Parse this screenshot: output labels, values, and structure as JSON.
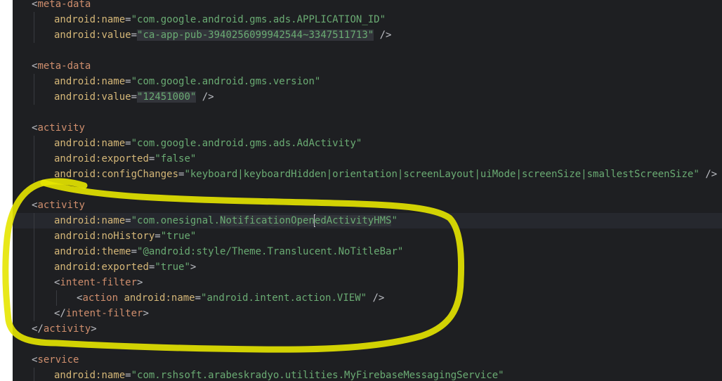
{
  "editor": {
    "lines": [
      {
        "id": "l1",
        "parts": [
          {
            "t": "<",
            "c": "p"
          },
          {
            "t": "meta-data",
            "c": "kw-tag"
          }
        ]
      },
      {
        "id": "l2",
        "parts": [
          {
            "t": "android:",
            "c": "kw-ns"
          },
          {
            "t": "name",
            "c": "kw-ns"
          },
          {
            "t": "=",
            "c": "p"
          },
          {
            "t": "\"com.google.android.gms.ads.APPLICATION_ID\"",
            "c": "val"
          }
        ]
      },
      {
        "id": "l3",
        "parts": [
          {
            "t": "android:",
            "c": "kw-ns"
          },
          {
            "t": "value",
            "c": "kw-ns"
          },
          {
            "t": "=",
            "c": "p"
          },
          {
            "t": "\"ca-app-pub-3940256099942544~3347511713\"",
            "c": "val hl"
          },
          {
            "t": " />",
            "c": "p"
          }
        ]
      },
      {
        "id": "l4",
        "parts": []
      },
      {
        "id": "l5",
        "parts": [
          {
            "t": "<",
            "c": "p"
          },
          {
            "t": "meta-data",
            "c": "kw-tag"
          }
        ]
      },
      {
        "id": "l6",
        "parts": [
          {
            "t": "android:",
            "c": "kw-ns"
          },
          {
            "t": "name",
            "c": "kw-ns"
          },
          {
            "t": "=",
            "c": "p"
          },
          {
            "t": "\"com.google.android.gms.version\"",
            "c": "val"
          }
        ]
      },
      {
        "id": "l7",
        "parts": [
          {
            "t": "android:",
            "c": "kw-ns"
          },
          {
            "t": "value",
            "c": "kw-ns"
          },
          {
            "t": "=",
            "c": "p"
          },
          {
            "t": "\"12451000\"",
            "c": "val hl"
          },
          {
            "t": " />",
            "c": "p"
          }
        ]
      },
      {
        "id": "l8",
        "parts": []
      },
      {
        "id": "l9",
        "parts": [
          {
            "t": "<",
            "c": "p"
          },
          {
            "t": "activity",
            "c": "kw-tag"
          }
        ]
      },
      {
        "id": "l10",
        "parts": [
          {
            "t": "android:",
            "c": "kw-ns"
          },
          {
            "t": "name",
            "c": "kw-ns"
          },
          {
            "t": "=",
            "c": "p"
          },
          {
            "t": "\"com.google.android.gms.ads.AdActivity\"",
            "c": "val"
          }
        ]
      },
      {
        "id": "l11",
        "parts": [
          {
            "t": "android:",
            "c": "kw-ns"
          },
          {
            "t": "exported",
            "c": "kw-ns"
          },
          {
            "t": "=",
            "c": "p"
          },
          {
            "t": "\"false\"",
            "c": "val"
          }
        ]
      },
      {
        "id": "l12",
        "parts": [
          {
            "t": "android:",
            "c": "kw-ns"
          },
          {
            "t": "configChanges",
            "c": "kw-ns"
          },
          {
            "t": "=",
            "c": "p"
          },
          {
            "t": "\"keyboard|keyboardHidden|orientation|screenLayout|uiMode|screenSize|smallestScreenSize\"",
            "c": "val"
          },
          {
            "t": " />",
            "c": "p"
          }
        ]
      },
      {
        "id": "l13",
        "parts": []
      },
      {
        "id": "l14",
        "parts": [
          {
            "t": "<",
            "c": "p"
          },
          {
            "t": "activity",
            "c": "kw-tag"
          }
        ]
      },
      {
        "id": "l15",
        "parts": [
          {
            "t": "android:",
            "c": "kw-ns"
          },
          {
            "t": "name",
            "c": "kw-ns"
          },
          {
            "t": "=",
            "c": "p"
          },
          {
            "t": "\"com.onesignal.",
            "c": "val"
          },
          {
            "t": "NotificationOpen",
            "c": "val hl"
          },
          {
            "t": "|",
            "c": "caret"
          },
          {
            "t": "edActivityHMS",
            "c": "val hl"
          },
          {
            "t": "\"",
            "c": "val"
          }
        ]
      },
      {
        "id": "l16",
        "parts": [
          {
            "t": "android:",
            "c": "kw-ns"
          },
          {
            "t": "noHistory",
            "c": "kw-ns"
          },
          {
            "t": "=",
            "c": "p"
          },
          {
            "t": "\"true\"",
            "c": "val"
          }
        ]
      },
      {
        "id": "l17",
        "parts": [
          {
            "t": "android:",
            "c": "kw-ns"
          },
          {
            "t": "theme",
            "c": "kw-ns"
          },
          {
            "t": "=",
            "c": "p"
          },
          {
            "t": "\"@android:style/Theme.Translucent.NoTitleBar\"",
            "c": "val"
          }
        ]
      },
      {
        "id": "l18",
        "parts": [
          {
            "t": "android:",
            "c": "kw-ns"
          },
          {
            "t": "exported",
            "c": "kw-ns"
          },
          {
            "t": "=",
            "c": "p"
          },
          {
            "t": "\"true\"",
            "c": "val"
          },
          {
            "t": ">",
            "c": "p"
          }
        ]
      },
      {
        "id": "l19",
        "parts": [
          {
            "t": "<",
            "c": "p"
          },
          {
            "t": "intent-filter",
            "c": "kw-tag"
          },
          {
            "t": ">",
            "c": "p"
          }
        ]
      },
      {
        "id": "l20",
        "parts": [
          {
            "t": "<",
            "c": "p"
          },
          {
            "t": "action",
            "c": "kw-tag"
          },
          {
            "t": " ",
            "c": "p"
          },
          {
            "t": "android:",
            "c": "kw-ns"
          },
          {
            "t": "name",
            "c": "kw-ns"
          },
          {
            "t": "=",
            "c": "p"
          },
          {
            "t": "\"android.intent.action.VIEW\"",
            "c": "val"
          },
          {
            "t": " />",
            "c": "p"
          }
        ]
      },
      {
        "id": "l21",
        "parts": [
          {
            "t": "</",
            "c": "p"
          },
          {
            "t": "intent-filter",
            "c": "kw-tag"
          },
          {
            "t": ">",
            "c": "p"
          }
        ]
      },
      {
        "id": "l22",
        "parts": [
          {
            "t": "</",
            "c": "p"
          },
          {
            "t": "activity",
            "c": "kw-tag"
          },
          {
            "t": ">",
            "c": "p"
          }
        ]
      },
      {
        "id": "l23",
        "parts": []
      },
      {
        "id": "l24",
        "parts": [
          {
            "t": "<",
            "c": "p"
          },
          {
            "t": "service",
            "c": "kw-tag"
          }
        ]
      },
      {
        "id": "l25",
        "parts": [
          {
            "t": "android:",
            "c": "kw-ns"
          },
          {
            "t": "name",
            "c": "kw-ns"
          },
          {
            "t": "=",
            "c": "p"
          },
          {
            "t": "\"com.rshsoft.arabeskradyo.utilities.MyFirebaseMessagingService\"",
            "c": "val"
          }
        ]
      }
    ]
  },
  "colors": {
    "background": "#1e1f22",
    "tag": "#cf8e6d",
    "attribute": "#d5b778",
    "string": "#6aab73",
    "punctuation": "#bcbec4",
    "annotation_marker": "#e6e600"
  }
}
